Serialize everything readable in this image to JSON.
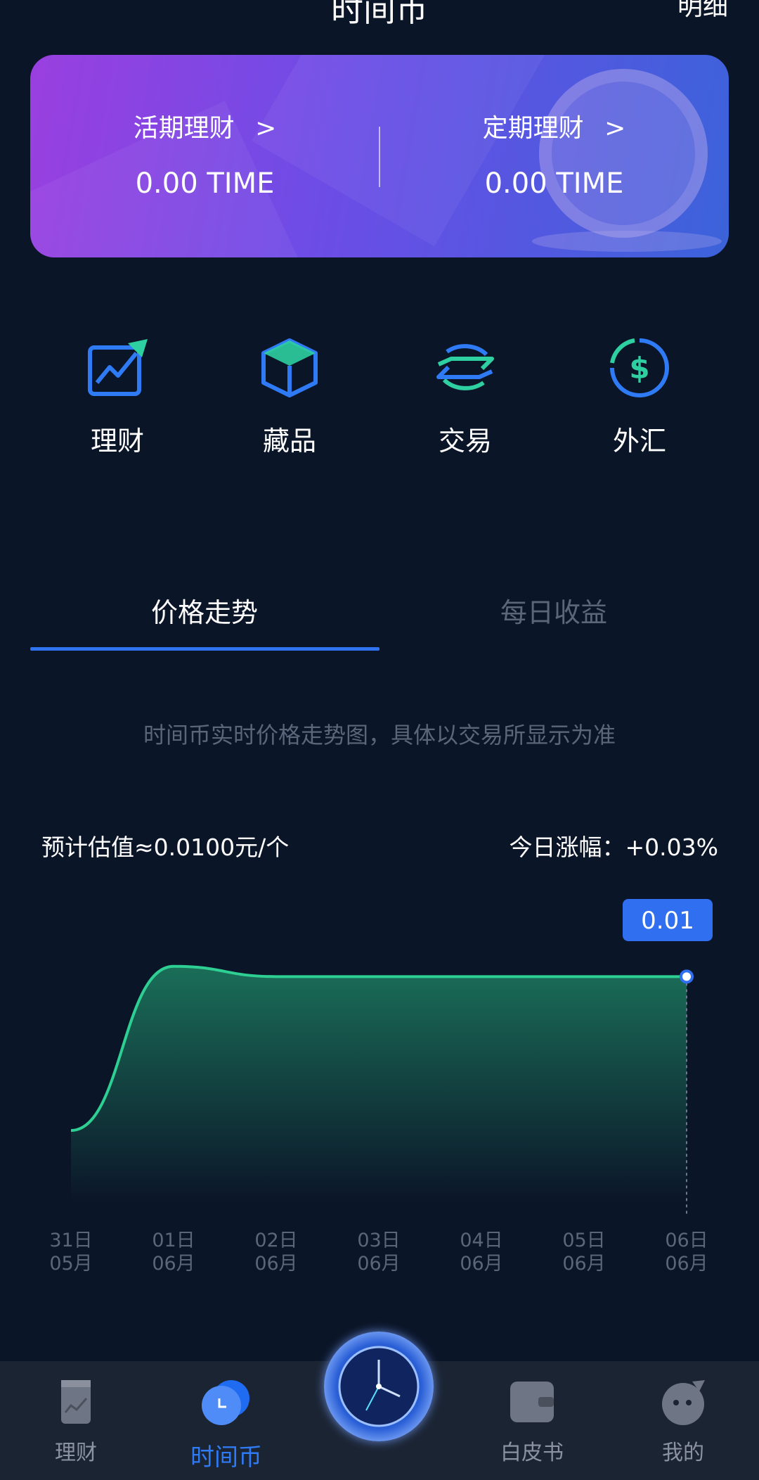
{
  "header": {
    "title": "时间币",
    "detail_label": "明细"
  },
  "card": {
    "left": {
      "label": "活期理财",
      "chevron": ">",
      "value": "0.00 TIME"
    },
    "right": {
      "label": "定期理财",
      "chevron": ">",
      "value": "0.00 TIME"
    }
  },
  "nav": [
    {
      "label": "理财",
      "icon": "chart-up-icon"
    },
    {
      "label": "藏品",
      "icon": "cube-icon"
    },
    {
      "label": "交易",
      "icon": "exchange-icon"
    },
    {
      "label": "外汇",
      "icon": "dollar-icon"
    }
  ],
  "tabs": [
    {
      "label": "价格走势",
      "active": true
    },
    {
      "label": "每日收益",
      "active": false
    }
  ],
  "chart_note": "时间币实时价格走势图，具体以交易所显示为准",
  "estimate": "预计估值≈0.0100元/个",
  "today_change": "今日涨幅：+0.03%",
  "chart_data": {
    "type": "area",
    "x_days": [
      "31日",
      "01日",
      "02日",
      "03日",
      "04日",
      "05日",
      "06日"
    ],
    "x_months": [
      "05月",
      "06月",
      "06月",
      "06月",
      "06月",
      "06月",
      "06月"
    ],
    "values": [
      0.007,
      0.0102,
      0.01,
      0.01,
      0.01,
      0.01,
      0.01
    ],
    "tooltip": "0.01",
    "colors": {
      "line": "#2ecf93",
      "fill_top": "#1a6e58",
      "fill_bottom": "#0b1528"
    }
  },
  "bottom_nav": [
    {
      "label": "理财",
      "active": false
    },
    {
      "label": "时间币",
      "active": true
    },
    {
      "label": "白皮书",
      "active": false
    },
    {
      "label": "我的",
      "active": false
    }
  ],
  "colors": {
    "background": "#0b1528",
    "accent": "#2f73f0",
    "muted": "#5b667a"
  }
}
